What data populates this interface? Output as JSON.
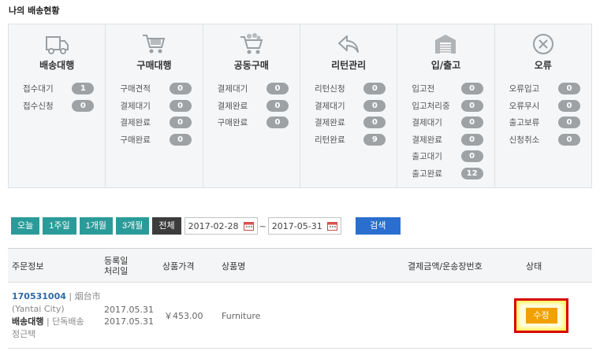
{
  "page": {
    "title": "나의 배송현황"
  },
  "status_columns": [
    {
      "icon": "truck-icon",
      "title": "배송대행",
      "rows": [
        {
          "label": "접수대기",
          "count": "1"
        },
        {
          "label": "접수신청",
          "count": "0"
        }
      ]
    },
    {
      "icon": "shopping-cart-icon",
      "title": "구매대행",
      "rows": [
        {
          "label": "구매견적",
          "count": "0"
        },
        {
          "label": "결제대기",
          "count": "0"
        },
        {
          "label": "결제완료",
          "count": "0"
        },
        {
          "label": "구매완료",
          "count": "0"
        }
      ]
    },
    {
      "icon": "group-cart-icon",
      "title": "공동구매",
      "rows": [
        {
          "label": "결제대기",
          "count": "0"
        },
        {
          "label": "결제완료",
          "count": "0"
        },
        {
          "label": "구매완료",
          "count": "0"
        }
      ]
    },
    {
      "icon": "return-arrow-icon",
      "title": "리턴관리",
      "rows": [
        {
          "label": "리턴신청",
          "count": "0"
        },
        {
          "label": "결제대기",
          "count": "0"
        },
        {
          "label": "결제완료",
          "count": "0"
        },
        {
          "label": "리턴완료",
          "count": "9"
        }
      ]
    },
    {
      "icon": "warehouse-icon",
      "title": "입/출고",
      "rows": [
        {
          "label": "입고전",
          "count": "0"
        },
        {
          "label": "입고처리중",
          "count": "0"
        },
        {
          "label": "결제대기",
          "count": "0"
        },
        {
          "label": "결제완료",
          "count": "0"
        },
        {
          "label": "출고대기",
          "count": "0"
        },
        {
          "label": "출고완료",
          "count": "12"
        }
      ]
    },
    {
      "icon": "error-x-icon",
      "title": "오류",
      "rows": [
        {
          "label": "오류입고",
          "count": "0"
        },
        {
          "label": "오류무시",
          "count": "0"
        },
        {
          "label": "출고보류",
          "count": "0"
        },
        {
          "label": "신청취소",
          "count": "0"
        }
      ]
    }
  ],
  "filter": {
    "periods": [
      "오늘",
      "1주일",
      "1개월",
      "3개월",
      "전체"
    ],
    "date_from": "2017-02-28",
    "date_to": "2017-05-31",
    "separator": "~",
    "search_label": "검색"
  },
  "table": {
    "headers": {
      "order_info": "주문정보",
      "dates_line1": "등록일",
      "dates_line2": "처리일",
      "price": "상품가격",
      "product": "상품명",
      "payment": "결제금액/운송장번호",
      "status": "상태"
    },
    "rows": [
      {
        "order_no": "170531004",
        "city": " | 烟台市",
        "city_en": "(Yantai City)",
        "service": "배송대행",
        "service_type": " | 단독배송",
        "customer": "정근택",
        "registered": "2017.05.31",
        "processed": "2017.05.31",
        "price": "￥453.00",
        "product": "Furniture",
        "edit_label": "수정"
      }
    ]
  },
  "colors": {
    "teal": "#2b9b9a",
    "blue": "#2a6fd0",
    "orange": "#f1a000",
    "highlight_red": "#d90000"
  }
}
